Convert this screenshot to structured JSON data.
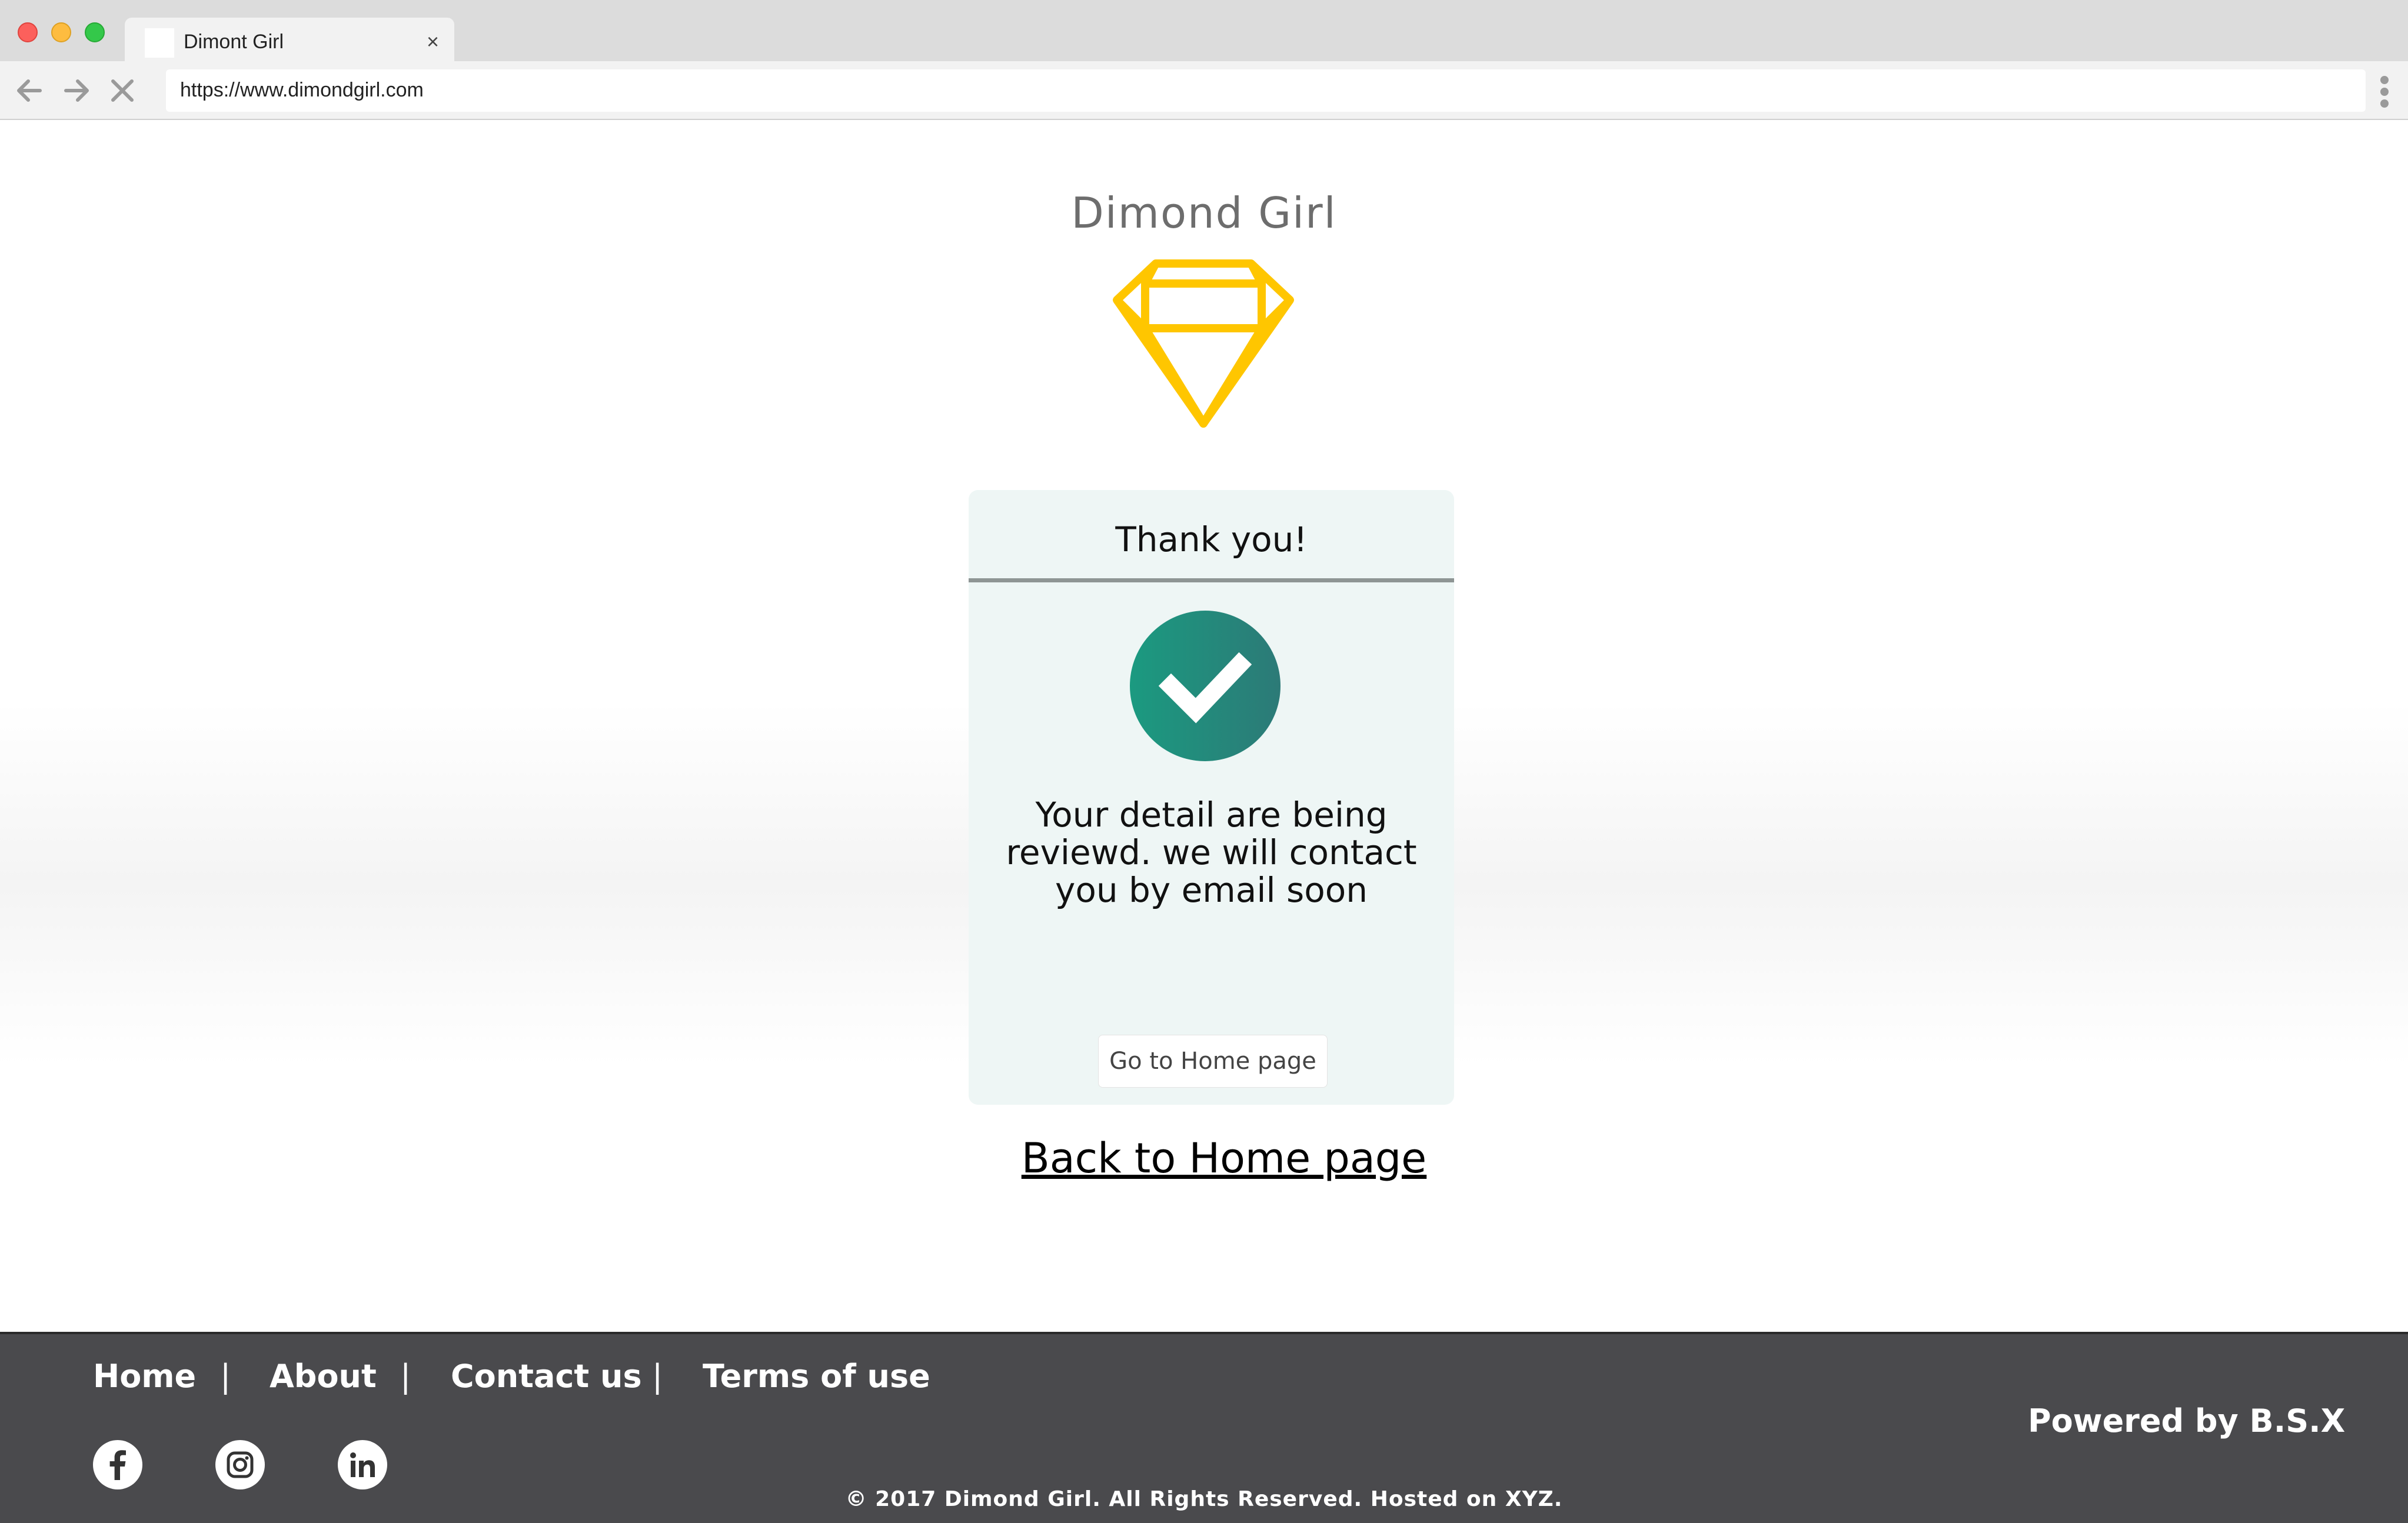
{
  "browser": {
    "tab_title": "Dimont Girl",
    "tab_close": "×",
    "url": "https://www.dimondgirl.com"
  },
  "page": {
    "brand": "Dimond Girl",
    "card": {
      "title": "Thank you!",
      "message": "Your detail are being reviewd. we will contact you by email soon",
      "button": "Go to Home page"
    },
    "back_link": "Back to Home page"
  },
  "footer": {
    "nav": [
      "Home",
      "About",
      "Contact us",
      "Terms of use"
    ],
    "separator": "|",
    "social": [
      "facebook-icon",
      "instagram-icon",
      "linkedin-icon"
    ],
    "powered": "Powered by B.S.X",
    "copyright": "© 2017 Dimond Girl. All Rights Reserved. Hosted on XYZ."
  },
  "colors": {
    "diamond": "#ffc600",
    "check_start": "#1b9a80",
    "check_end": "#2c7a77",
    "card_bg": "#eef6f5",
    "footer_bg": "#4a4a4d"
  }
}
